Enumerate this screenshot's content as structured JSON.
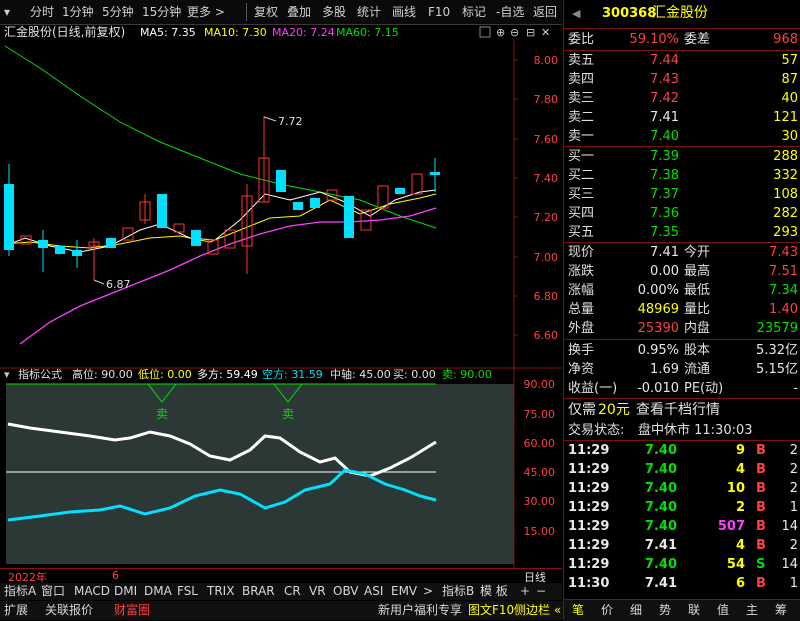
{
  "toolbar": {
    "items": [
      "分时",
      "1分钟",
      "5分钟",
      "15分钟",
      "更多 >",
      "复权",
      "叠加",
      "多股",
      "统计",
      "画线",
      "F10",
      "标记",
      "-自选",
      "返回"
    ]
  },
  "chart": {
    "title": "汇金股份(日线,前复权)",
    "ma5": "MA5: 7.35",
    "ma10": "MA10: 7.30",
    "ma20": "MA20: 7.24",
    "ma60": "MA60: 7.15",
    "price_axis": [
      "8.00",
      "7.80",
      "7.60",
      "7.40",
      "7.20",
      "7.00",
      "6.80",
      "6.60"
    ],
    "high_label": "7.72",
    "low_label": "6.87",
    "colors": {
      "up": "#ff3333",
      "down": "#00e0ff",
      "ma5": "#ffffff",
      "ma10": "#ffff00",
      "ma20": "#ff40ff",
      "ma60": "#00e000"
    }
  },
  "indicator": {
    "name": "指标公式",
    "gaowei": "高位: 90.00",
    "diwei": "低位: 0.00",
    "duofang": "多方: 59.49",
    "kongfang": "空方: 31.59",
    "zhongzhou": "中轴: 45.00",
    "mai": "买: 0.00",
    "sell": "卖: 90.00",
    "sell_mark": "卖",
    "axis": [
      "90.00",
      "75.00",
      "60.00",
      "45.00",
      "30.00",
      "15.00"
    ]
  },
  "timeline": {
    "year": "2022年",
    "month": "6",
    "period": "日线"
  },
  "indicator_tabs": [
    "指标A",
    "窗口",
    "MACD",
    "DMI",
    "DMA",
    "FSL",
    "TRIX",
    "BRAR",
    "CR",
    "VR",
    "OBV",
    "ASI",
    "EMV",
    ">",
    "指标B",
    "模 板"
  ],
  "bottom_tabs": [
    "扩展",
    "关联报价",
    "财富圈"
  ],
  "bottom_right": [
    "新用户福利专享",
    "图文F10",
    "侧边栏 «"
  ],
  "quote": {
    "code": "300368",
    "name": "汇金股份",
    "weibi_label": "委比",
    "weibi": "59.10%",
    "weicha_label": "委差",
    "weicha": "968",
    "asks": [
      {
        "label": "卖五",
        "price": "7.44",
        "vol": "57"
      },
      {
        "label": "卖四",
        "price": "7.43",
        "vol": "87"
      },
      {
        "label": "卖三",
        "price": "7.42",
        "vol": "40"
      },
      {
        "label": "卖二",
        "price": "7.41",
        "vol": "121"
      },
      {
        "label": "卖一",
        "price": "7.40",
        "vol": "30"
      }
    ],
    "bids": [
      {
        "label": "买一",
        "price": "7.39",
        "vol": "288"
      },
      {
        "label": "买二",
        "price": "7.38",
        "vol": "332"
      },
      {
        "label": "买三",
        "price": "7.37",
        "vol": "108"
      },
      {
        "label": "买四",
        "price": "7.36",
        "vol": "282"
      },
      {
        "label": "买五",
        "price": "7.35",
        "vol": "293"
      }
    ],
    "stats": [
      {
        "l1": "现价",
        "v1": "7.41",
        "l2": "今开",
        "v2": "7.43"
      },
      {
        "l1": "涨跌",
        "v1": "0.00",
        "l2": "最高",
        "v2": "7.51"
      },
      {
        "l1": "涨幅",
        "v1": "0.00%",
        "l2": "最低",
        "v2": "7.34"
      },
      {
        "l1": "总量",
        "v1": "48969",
        "l2": "量比",
        "v2": "1.40"
      },
      {
        "l1": "外盘",
        "v1": "25390",
        "l2": "内盘",
        "v2": "23579"
      }
    ],
    "stats2": [
      {
        "l1": "换手",
        "v1": "0.95%",
        "l2": "股本",
        "v2": "5.32亿"
      },
      {
        "l1": "净资",
        "v1": "1.69",
        "l2": "流通",
        "v2": "5.15亿"
      },
      {
        "l1": "收益(一)",
        "v1": "-0.010",
        "l2": "PE(动)",
        "v2": "-"
      }
    ],
    "promo_prefix": "仅需",
    "promo_highlight": "20元",
    "promo_suffix": "查看千档行情",
    "trade_status_label": "交易状态:",
    "trade_status": "盘中休市 11:30:03",
    "ticks": [
      {
        "time": "11:29",
        "price": "7.40",
        "vol": "9",
        "bs": "B",
        "n": "2"
      },
      {
        "time": "11:29",
        "price": "7.40",
        "vol": "4",
        "bs": "B",
        "n": "2"
      },
      {
        "time": "11:29",
        "price": "7.40",
        "vol": "10",
        "bs": "B",
        "n": "2"
      },
      {
        "time": "11:29",
        "price": "7.40",
        "vol": "2",
        "bs": "B",
        "n": "1"
      },
      {
        "time": "11:29",
        "price": "7.40",
        "vol": "507",
        "bs": "B",
        "n": "14"
      },
      {
        "time": "11:29",
        "price": "7.41",
        "vol": "4",
        "bs": "B",
        "n": "2"
      },
      {
        "time": "11:29",
        "price": "7.40",
        "vol": "54",
        "bs": "S",
        "n": "14"
      },
      {
        "time": "11:30",
        "price": "7.41",
        "vol": "6",
        "bs": "B",
        "n": "1"
      }
    ],
    "side_tabs": [
      "笔",
      "价",
      "细",
      "势",
      "联",
      "值",
      "主",
      "筹"
    ]
  }
}
